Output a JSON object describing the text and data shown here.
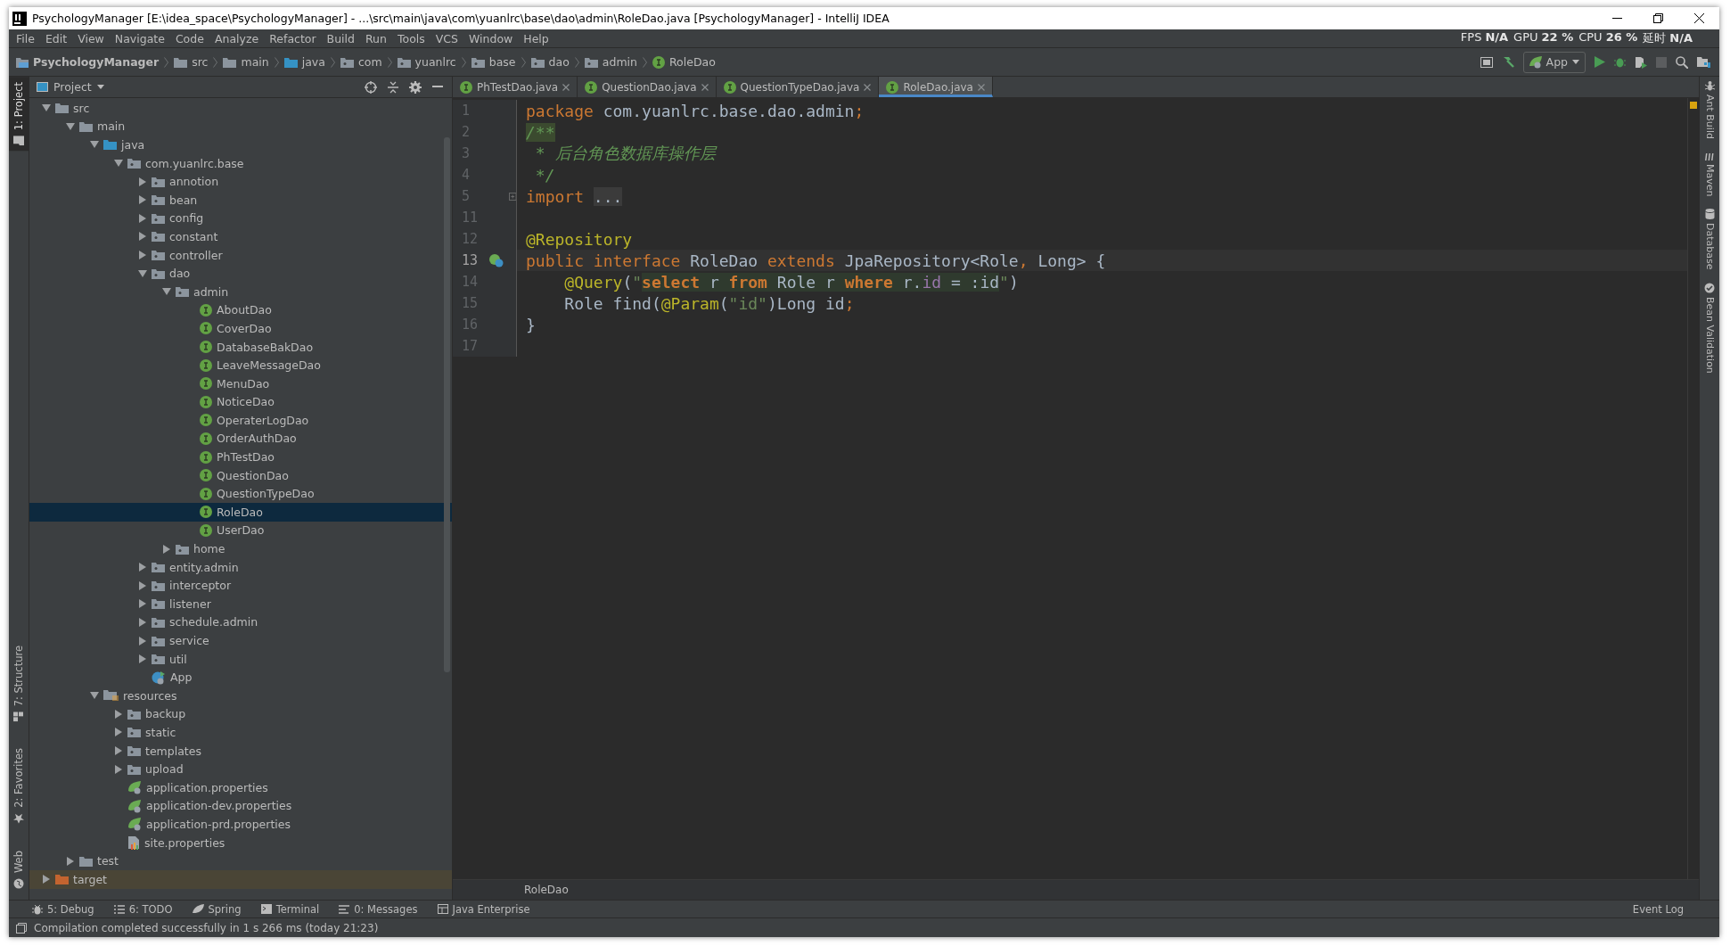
{
  "window": {
    "title": "PsychologyManager [E:\\idea_space\\PsychologyManager] - ...\\src\\main\\java\\com\\yuanlrc\\base\\dao\\admin\\RoleDao.java [PsychologyManager] - IntelliJ IDEA"
  },
  "menu": [
    "File",
    "Edit",
    "View",
    "Navigate",
    "Code",
    "Analyze",
    "Refactor",
    "Build",
    "Run",
    "Tools",
    "VCS",
    "Window",
    "Help"
  ],
  "perf_overlay": [
    {
      "label": "FPS",
      "value": "N/A"
    },
    {
      "label": "GPU",
      "value": "22 %"
    },
    {
      "label": "CPU",
      "value": "26 %"
    },
    {
      "label": "延时",
      "value": "N/A"
    }
  ],
  "breadcrumbs": [
    {
      "label": "PsychologyManager",
      "kind": "project"
    },
    {
      "label": "src",
      "kind": "folder"
    },
    {
      "label": "main",
      "kind": "folder"
    },
    {
      "label": "java",
      "kind": "source-root"
    },
    {
      "label": "com",
      "kind": "package"
    },
    {
      "label": "yuanlrc",
      "kind": "package"
    },
    {
      "label": "base",
      "kind": "package"
    },
    {
      "label": "dao",
      "kind": "package"
    },
    {
      "label": "admin",
      "kind": "package"
    },
    {
      "label": "RoleDao",
      "kind": "interface"
    }
  ],
  "run_config": "App",
  "left_toolbar": [
    {
      "label": "1: Project",
      "selected": true,
      "kind": "project"
    },
    {
      "label": "7: Structure",
      "selected": false,
      "kind": "structure"
    },
    {
      "label": "2: Favorites",
      "selected": false,
      "kind": "favorites"
    },
    {
      "label": "Web",
      "selected": false,
      "kind": "web"
    }
  ],
  "project_panel": {
    "title": "Project"
  },
  "tree": {
    "items": [
      {
        "label": "src",
        "kind": "folder",
        "expanded": true,
        "selected": false,
        "children": [
          {
            "label": "main",
            "kind": "folder",
            "expanded": true,
            "selected": false,
            "children": [
              {
                "label": "java",
                "kind": "source-root",
                "expanded": true,
                "selected": false,
                "children": [
                  {
                    "label": "com.yuanlrc.base",
                    "kind": "package",
                    "expanded": true,
                    "selected": false,
                    "children": [
                      {
                        "label": "annotion",
                        "kind": "package",
                        "expanded": false,
                        "selected": false
                      },
                      {
                        "label": "bean",
                        "kind": "package",
                        "expanded": false,
                        "selected": false
                      },
                      {
                        "label": "config",
                        "kind": "package",
                        "expanded": false,
                        "selected": false
                      },
                      {
                        "label": "constant",
                        "kind": "package",
                        "expanded": false,
                        "selected": false
                      },
                      {
                        "label": "controller",
                        "kind": "package",
                        "expanded": false,
                        "selected": false
                      },
                      {
                        "label": "dao",
                        "kind": "package",
                        "expanded": true,
                        "selected": false,
                        "children": [
                          {
                            "label": "admin",
                            "kind": "package",
                            "expanded": true,
                            "selected": false,
                            "children": [
                              {
                                "label": "AboutDao",
                                "kind": "interface",
                                "selected": false
                              },
                              {
                                "label": "CoverDao",
                                "kind": "interface",
                                "selected": false
                              },
                              {
                                "label": "DatabaseBakDao",
                                "kind": "interface",
                                "selected": false
                              },
                              {
                                "label": "LeaveMessageDao",
                                "kind": "interface",
                                "selected": false
                              },
                              {
                                "label": "MenuDao",
                                "kind": "interface",
                                "selected": false
                              },
                              {
                                "label": "NoticeDao",
                                "kind": "interface",
                                "selected": false
                              },
                              {
                                "label": "OperaterLogDao",
                                "kind": "interface",
                                "selected": false
                              },
                              {
                                "label": "OrderAuthDao",
                                "kind": "interface",
                                "selected": false
                              },
                              {
                                "label": "PhTestDao",
                                "kind": "interface",
                                "selected": false
                              },
                              {
                                "label": "QuestionDao",
                                "kind": "interface",
                                "selected": false
                              },
                              {
                                "label": "QuestionTypeDao",
                                "kind": "interface",
                                "selected": false
                              },
                              {
                                "label": "RoleDao",
                                "kind": "interface",
                                "selected": true
                              },
                              {
                                "label": "UserDao",
                                "kind": "interface",
                                "selected": false
                              }
                            ]
                          },
                          {
                            "label": "home",
                            "kind": "package",
                            "expanded": false,
                            "selected": false
                          }
                        ]
                      },
                      {
                        "label": "entity.admin",
                        "kind": "package",
                        "expanded": false,
                        "selected": false
                      },
                      {
                        "label": "interceptor",
                        "kind": "package",
                        "expanded": false,
                        "selected": false
                      },
                      {
                        "label": "listener",
                        "kind": "package",
                        "expanded": false,
                        "selected": false
                      },
                      {
                        "label": "schedule.admin",
                        "kind": "package",
                        "expanded": false,
                        "selected": false
                      },
                      {
                        "label": "service",
                        "kind": "package",
                        "expanded": false,
                        "selected": false
                      },
                      {
                        "label": "util",
                        "kind": "package",
                        "expanded": false,
                        "selected": false
                      },
                      {
                        "label": "App",
                        "kind": "spring-class",
                        "selected": false
                      }
                    ]
                  }
                ]
              },
              {
                "label": "resources",
                "kind": "resources-root",
                "expanded": true,
                "selected": false,
                "children": [
                  {
                    "label": "backup",
                    "kind": "package",
                    "expanded": false,
                    "selected": false
                  },
                  {
                    "label": "static",
                    "kind": "package",
                    "expanded": false,
                    "selected": false
                  },
                  {
                    "label": "templates",
                    "kind": "package",
                    "expanded": false,
                    "selected": false
                  },
                  {
                    "label": "upload",
                    "kind": "package",
                    "expanded": false,
                    "selected": false
                  },
                  {
                    "label": "application.properties",
                    "kind": "spring-config",
                    "selected": false
                  },
                  {
                    "label": "application-dev.properties",
                    "kind": "spring-config",
                    "selected": false
                  },
                  {
                    "label": "application-prd.properties",
                    "kind": "spring-config",
                    "selected": false
                  },
                  {
                    "label": "site.properties",
                    "kind": "properties",
                    "selected": false
                  }
                ]
              }
            ]
          },
          {
            "label": "test",
            "kind": "folder",
            "expanded": false,
            "selected": false
          }
        ]
      },
      {
        "label": "target",
        "kind": "excluded-folder",
        "expanded": false,
        "selected": false
      }
    ]
  },
  "editor": {
    "tabs": [
      {
        "label": "PhTestDao.java",
        "selected": false
      },
      {
        "label": "QuestionDao.java",
        "selected": false
      },
      {
        "label": "QuestionTypeDao.java",
        "selected": false
      },
      {
        "label": "RoleDao.java",
        "selected": true
      }
    ],
    "lines": [
      {
        "number": "1",
        "current": false,
        "tokens": [
          {
            "text": "package",
            "kind": "keyword"
          },
          {
            "text": " com.yuanlrc.base.dao.admin",
            "kind": "plain"
          },
          {
            "text": ";",
            "kind": "keyword"
          }
        ]
      },
      {
        "number": "2",
        "current": false,
        "tokens": [
          {
            "text": "/**",
            "kind": "doc-marker"
          }
        ]
      },
      {
        "number": "3",
        "current": false,
        "tokens": [
          {
            "text": " * 后台角色数据库操作层",
            "kind": "comment"
          }
        ]
      },
      {
        "number": "4",
        "current": false,
        "tokens": [
          {
            "text": " */",
            "kind": "comment"
          }
        ]
      },
      {
        "number": "5",
        "current": false,
        "tokens": [
          {
            "text": "import ",
            "kind": "keyword"
          },
          {
            "text": "...",
            "kind": "folded"
          }
        ]
      },
      {
        "number": "11",
        "current": false
      },
      {
        "number": "12",
        "current": false,
        "tokens": [
          {
            "text": "@Repository",
            "kind": "annotation"
          }
        ]
      },
      {
        "number": "13",
        "current": true,
        "tokens": [
          {
            "text": "public interface ",
            "kind": "keyword"
          },
          {
            "text": "RoleDao ",
            "kind": "plain"
          },
          {
            "text": "extends ",
            "kind": "keyword"
          },
          {
            "text": "JpaRepository<Role",
            "kind": "plain"
          },
          {
            "text": ",",
            "kind": "keyword"
          },
          {
            "text": " Long> {",
            "kind": "plain"
          }
        ]
      },
      {
        "number": "14",
        "current": false,
        "tokens": [
          {
            "text": "    @Query",
            "kind": "annotation"
          },
          {
            "text": "(",
            "kind": "plain"
          },
          {
            "text": "\"",
            "kind": "string"
          },
          {
            "text": "select",
            "kind": "sql-keyword"
          },
          {
            "text": " r ",
            "kind": "sql-text"
          },
          {
            "text": "from",
            "kind": "sql-keyword"
          },
          {
            "text": " Role r ",
            "kind": "sql-text"
          },
          {
            "text": "where",
            "kind": "sql-keyword"
          },
          {
            "text": " r.",
            "kind": "sql-text"
          },
          {
            "text": "id",
            "kind": "sql-field"
          },
          {
            "text": " = :id",
            "kind": "sql-text"
          },
          {
            "text": "\"",
            "kind": "string"
          },
          {
            "text": ")",
            "kind": "plain"
          }
        ]
      },
      {
        "number": "15",
        "current": false,
        "tokens": [
          {
            "text": "    Role find(",
            "kind": "plain"
          },
          {
            "text": "@Param",
            "kind": "annotation"
          },
          {
            "text": "(",
            "kind": "plain"
          },
          {
            "text": "\"id\"",
            "kind": "string"
          },
          {
            "text": ")Long id",
            "kind": "plain"
          },
          {
            "text": ";",
            "kind": "keyword"
          }
        ]
      },
      {
        "number": "16",
        "current": false,
        "tokens": [
          {
            "text": "}",
            "kind": "plain"
          }
        ]
      },
      {
        "number": "17",
        "current": false
      }
    ],
    "breadcrumb": "RoleDao"
  },
  "right_toolbar": [
    {
      "label": "Ant Build",
      "kind": "ant"
    },
    {
      "label": "Maven",
      "kind": "maven"
    },
    {
      "label": "Database",
      "kind": "database"
    },
    {
      "label": "Bean Validation",
      "kind": "bean"
    }
  ],
  "bottom_toolbar": [
    {
      "label": "5: Debug",
      "kind": "debug"
    },
    {
      "label": "6: TODO",
      "kind": "todo"
    },
    {
      "label": "Spring",
      "kind": "spring"
    },
    {
      "label": "Terminal",
      "kind": "terminal"
    },
    {
      "label": "0: Messages",
      "kind": "messages"
    },
    {
      "label": "Java Enterprise",
      "kind": "enterprise"
    }
  ],
  "event_log": "Event Log",
  "status_bar": {
    "message": "Compilation completed successfully in 1 s 266 ms (today 21:23)"
  }
}
